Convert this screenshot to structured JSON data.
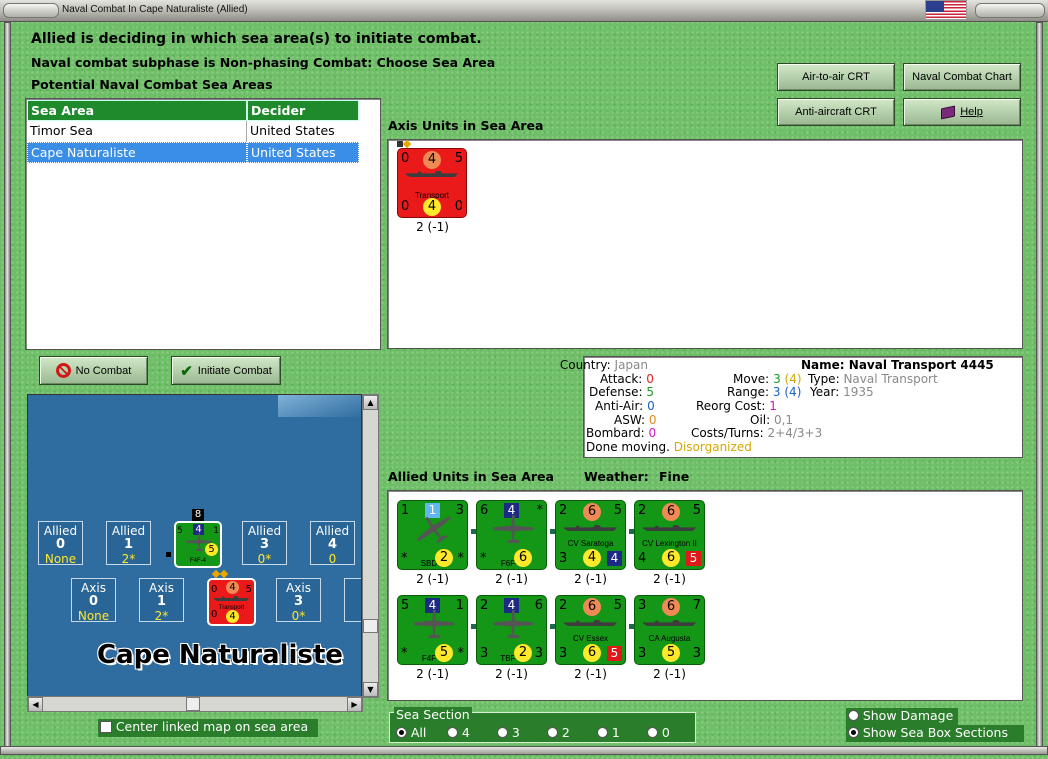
{
  "window": {
    "title": "Naval Combat In Cape Naturaliste (Allied)"
  },
  "header": {
    "line1": "Allied is deciding in which sea area(s) to initiate combat.",
    "line2": "Naval combat subphase is Non-phasing Combat: Choose Sea Area",
    "line3": "Potential Naval Combat Sea Areas"
  },
  "buttons": {
    "air_to_air": "Air-to-air CRT",
    "naval_chart": "Naval Combat Chart",
    "anti_aircraft": "Anti-aircraft CRT",
    "help": "Help",
    "no_combat": "No Combat",
    "initiate": "Initiate Combat"
  },
  "table": {
    "headers": [
      "Sea Area",
      "Decider"
    ],
    "rows": [
      {
        "sea": "Timor Sea",
        "decider": "United States"
      },
      {
        "sea": "Cape Naturaliste",
        "decider": "United States"
      }
    ]
  },
  "axis_panel": {
    "label": "Axis Units in Sea Area",
    "unit": {
      "tl": "0",
      "circle_top": "4",
      "tr": "5",
      "name": "Transport",
      "bl": "0",
      "circle_bottom": "4",
      "br": "0",
      "caption": "2 (-1)"
    }
  },
  "info": {
    "country_k": "Country:",
    "country_v": "Japan",
    "attack_k": "Attack:",
    "attack_v": "0",
    "defense_k": "Defense:",
    "defense_v": "5",
    "aa_k": "Anti-Air:",
    "aa_v": "0",
    "asw_k": "ASW:",
    "asw_v": "0",
    "bombard_k": "Bombard:",
    "bombard_v": "0",
    "done": "Done moving.",
    "status": "Disorganized",
    "name_k": "Name:",
    "name_v": "Naval Transport 4445",
    "move_k": "Move:",
    "move_v": "3",
    "move_v2": "(4)",
    "type_k": "Type:",
    "type_v": "Naval Transport",
    "range_k": "Range:",
    "range_v": "3",
    "range_v2": "(4)",
    "year_k": "Year:",
    "year_v": "1935",
    "reorg_k": "Reorg Cost:",
    "reorg_v": "1",
    "oil_k": "Oil:",
    "oil_v": "0,1",
    "costs_k": "Costs/Turns:",
    "costs_v": "2+4/3+3",
    "colors": {
      "value_gray": "#8a8a8a",
      "attack": "#e02020",
      "defense": "#1a9b1a",
      "aa": "#1a60c8",
      "asw": "#e08a1a",
      "bombard": "#c81ac8",
      "status": "#d4a800"
    }
  },
  "allied_panel": {
    "label": "Allied Units in Sea Area",
    "weather_label": "Weather:",
    "weather": "Fine",
    "units": [
      {
        "tl": "1",
        "top": "1",
        "top_style": "lblue",
        "tr": "3",
        "name": "SBD-1",
        "bl": "*",
        "bot": "2",
        "bot_style": "yellow",
        "br": "*",
        "art": "plane-diag",
        "caption": "2 (-1)"
      },
      {
        "tl": "6",
        "top": "4",
        "top_style": "navy",
        "tr": "*",
        "name": "F6F-3",
        "bl": "*",
        "bot": "6",
        "bot_style": "yellow",
        "br": "",
        "art": "plane",
        "caption": "2 (-1)"
      },
      {
        "tl": "2",
        "top": "6",
        "top_style": "orange",
        "tr": "5",
        "name": "CV Saratoga",
        "bl": "3",
        "bot": "4",
        "bot_style": "yellow",
        "br": "4",
        "br_style": "navy",
        "art": "ship",
        "caption": "2 (-1)"
      },
      {
        "tl": "2",
        "top": "6",
        "top_style": "orange",
        "tr": "5",
        "name": "CV Lexington II",
        "bl": "4",
        "bot": "6",
        "bot_style": "yellow",
        "br": "5",
        "br_style": "redsq",
        "art": "ship",
        "caption": "2 (-1)"
      },
      {
        "tl": "5",
        "top": "4",
        "top_style": "navy",
        "tr": "1",
        "name": "F4F-4",
        "bl": "*",
        "bot": "5",
        "bot_style": "yellow",
        "br": "*",
        "art": "plane",
        "caption": "2 (-1)"
      },
      {
        "tl": "2",
        "top": "4",
        "top_style": "navy",
        "tr": "6",
        "name": "TBF-1",
        "bl": "3",
        "bot": "2",
        "bot_style": "yellow",
        "br": "3",
        "art": "plane",
        "caption": "2 (-1)"
      },
      {
        "tl": "2",
        "top": "6",
        "top_style": "orange",
        "tr": "5",
        "name": "CV Essex",
        "bl": "3",
        "bot": "6",
        "bot_style": "yellow",
        "br": "5",
        "br_style": "redsq",
        "art": "ship",
        "caption": "2 (-1)"
      },
      {
        "tl": "3",
        "top": "6",
        "top_style": "orange",
        "tr": "7",
        "name": "CA Augusta",
        "bl": "3",
        "bot": "5",
        "bot_style": "yellow",
        "br": "3",
        "art": "ship",
        "caption": "2 (-1)"
      }
    ]
  },
  "map": {
    "title": "Cape Naturaliste",
    "allied_boxes": [
      {
        "label": "Allied",
        "num": "0",
        "val": "None"
      },
      {
        "label": "Allied",
        "num": "1",
        "val": "2*"
      },
      {
        "label": "Allied",
        "num": "3",
        "val": "0*"
      },
      {
        "label": "Allied",
        "num": "4",
        "val": "0"
      }
    ],
    "axis_boxes": [
      {
        "label": "Axis",
        "num": "0",
        "val": "None"
      },
      {
        "label": "Axis",
        "num": "1",
        "val": "2*"
      },
      {
        "label": "Axis",
        "num": "3",
        "val": "0*"
      },
      {
        "label": "A"
      }
    ],
    "stack_count": "8",
    "allied_counter": {
      "tl": "5",
      "top": "4",
      "tr": "1",
      "name": "F4F-4",
      "bot": "5"
    },
    "axis_counter": {
      "tl": "0",
      "top": "4",
      "tr": "5",
      "name": "Transport",
      "bl": "0",
      "bot": "4"
    }
  },
  "bottom": {
    "center_map": "Center linked map on sea area",
    "sea_section": "Sea Section",
    "sections": [
      "All",
      "4",
      "3",
      "2",
      "1",
      "0"
    ],
    "show_damage": "Show Damage",
    "show_sections": "Show Sea Box Sections"
  }
}
